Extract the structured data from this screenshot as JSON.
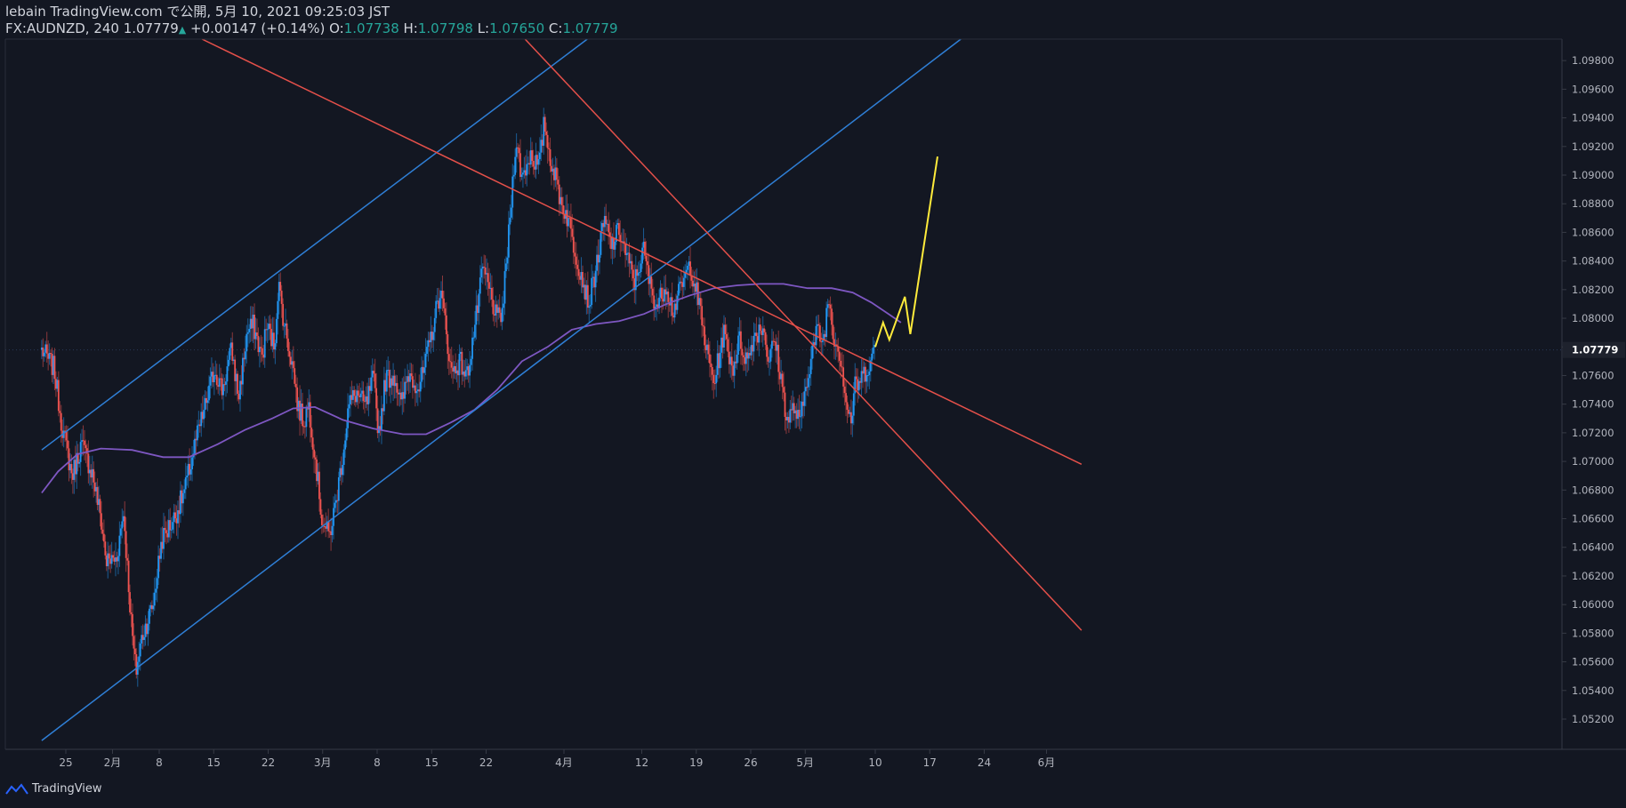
{
  "header": {
    "line1": "lebain TradingView.com で公開, 5月 10, 2021 09:25:03 JST",
    "symbol": "FX:AUDNZD, 240",
    "last": "1.07779",
    "change": "+0.00147 (+0.14%)",
    "o_label": "O:",
    "o_value": "1.07738",
    "h_label": "H:",
    "h_value": "1.07798",
    "l_label": "L:",
    "l_value": "1.07650",
    "c_label": "C:",
    "c_value": "1.07779"
  },
  "footer": {
    "brand": "TradingView"
  },
  "colors": {
    "background": "#131722",
    "up": "#2196f3",
    "down": "#ef5350",
    "ma": "#7e57c2",
    "channel_blue": "#2f7fd6",
    "channel_red": "#e4504a",
    "projection": "#ffeb3b",
    "axis_text": "#b2b5be"
  },
  "chart_data": {
    "type": "candlestick",
    "symbol": "FX:AUDNZD",
    "timeframe": "240",
    "ylim": [
      1.05,
      1.0995
    ],
    "y_ticks": [
      1.052,
      1.054,
      1.056,
      1.058,
      1.06,
      1.062,
      1.064,
      1.066,
      1.068,
      1.07,
      1.072,
      1.074,
      1.076,
      1.078,
      1.08,
      1.082,
      1.084,
      1.086,
      1.088,
      1.09,
      1.092,
      1.094,
      1.096,
      1.098
    ],
    "last_price": 1.07779,
    "last_price_label": "1.07779",
    "x_ticks": [
      {
        "label": "25",
        "day": -6
      },
      {
        "label": "2月",
        "day": 0
      },
      {
        "label": "8",
        "day": 6
      },
      {
        "label": "15",
        "day": 13
      },
      {
        "label": "22",
        "day": 20
      },
      {
        "label": "3月",
        "day": 27
      },
      {
        "label": "8",
        "day": 34
      },
      {
        "label": "15",
        "day": 41
      },
      {
        "label": "22",
        "day": 48
      },
      {
        "label": "4月",
        "day": 58
      },
      {
        "label": "12",
        "day": 68
      },
      {
        "label": "19",
        "day": 75
      },
      {
        "label": "26",
        "day": 82
      },
      {
        "label": "5月",
        "day": 89
      },
      {
        "label": "10",
        "day": 98
      },
      {
        "label": "17",
        "day": 105
      },
      {
        "label": "24",
        "day": 112
      },
      {
        "label": "6月",
        "day": 120
      }
    ],
    "price_path": [
      {
        "day": -9.1,
        "price": 1.0778
      },
      {
        "day": -7.5,
        "price": 1.0765
      },
      {
        "day": -6.5,
        "price": 1.0725
      },
      {
        "day": -5.2,
        "price": 1.069
      },
      {
        "day": -4.0,
        "price": 1.0712
      },
      {
        "day": -2.6,
        "price": 1.0692
      },
      {
        "day": -1.5,
        "price": 1.066
      },
      {
        "day": -0.8,
        "price": 1.063
      },
      {
        "day": 0.5,
        "price": 1.0632
      },
      {
        "day": 1.4,
        "price": 1.0665
      },
      {
        "day": 2.5,
        "price": 1.058
      },
      {
        "day": 3.0,
        "price": 1.0553
      },
      {
        "day": 3.8,
        "price": 1.0578
      },
      {
        "day": 5.2,
        "price": 1.06
      },
      {
        "day": 6.3,
        "price": 1.0645
      },
      {
        "day": 7.9,
        "price": 1.066
      },
      {
        "day": 9.3,
        "price": 1.068
      },
      {
        "day": 10.6,
        "price": 1.0712
      },
      {
        "day": 12.0,
        "price": 1.074
      },
      {
        "day": 13.1,
        "price": 1.0765
      },
      {
        "day": 14.1,
        "price": 1.075
      },
      {
        "day": 15.3,
        "price": 1.0778
      },
      {
        "day": 16.2,
        "price": 1.0745
      },
      {
        "day": 17.3,
        "price": 1.079
      },
      {
        "day": 18.1,
        "price": 1.0795
      },
      {
        "day": 19.2,
        "price": 1.0772
      },
      {
        "day": 19.8,
        "price": 1.0795
      },
      {
        "day": 20.8,
        "price": 1.078
      },
      {
        "day": 21.3,
        "price": 1.0825
      },
      {
        "day": 22.1,
        "price": 1.0795
      },
      {
        "day": 23.3,
        "price": 1.0762
      },
      {
        "day": 23.8,
        "price": 1.0738
      },
      {
        "day": 24.6,
        "price": 1.0728
      },
      {
        "day": 25.2,
        "price": 1.074
      },
      {
        "day": 26.1,
        "price": 1.07
      },
      {
        "day": 26.9,
        "price": 1.066
      },
      {
        "day": 27.8,
        "price": 1.0647
      },
      {
        "day": 28.6,
        "price": 1.0668
      },
      {
        "day": 29.6,
        "price": 1.0705
      },
      {
        "day": 30.3,
        "price": 1.0738
      },
      {
        "day": 31.3,
        "price": 1.0748
      },
      {
        "day": 32.5,
        "price": 1.0738
      },
      {
        "day": 33.5,
        "price": 1.0758
      },
      {
        "day": 34.2,
        "price": 1.072
      },
      {
        "day": 35.1,
        "price": 1.0758
      },
      {
        "day": 36.3,
        "price": 1.076
      },
      {
        "day": 37.1,
        "price": 1.0738
      },
      {
        "day": 38.0,
        "price": 1.0762
      },
      {
        "day": 39.4,
        "price": 1.0752
      },
      {
        "day": 40.1,
        "price": 1.0765
      },
      {
        "day": 41.2,
        "price": 1.0795
      },
      {
        "day": 42.1,
        "price": 1.082
      },
      {
        "day": 42.8,
        "price": 1.0795
      },
      {
        "day": 43.5,
        "price": 1.0762
      },
      {
        "day": 44.7,
        "price": 1.077
      },
      {
        "day": 45.5,
        "price": 1.0758
      },
      {
        "day": 46.7,
        "price": 1.08
      },
      {
        "day": 47.6,
        "price": 1.0835
      },
      {
        "day": 48.5,
        "price": 1.0818
      },
      {
        "day": 49.4,
        "price": 1.0798
      },
      {
        "day": 50.1,
        "price": 1.0805
      },
      {
        "day": 51.0,
        "price": 1.0865
      },
      {
        "day": 51.8,
        "price": 1.0925
      },
      {
        "day": 52.6,
        "price": 1.0898
      },
      {
        "day": 53.7,
        "price": 1.0915
      },
      {
        "day": 54.8,
        "price": 1.0905
      },
      {
        "day": 55.5,
        "price": 1.0938
      },
      {
        "day": 56.0,
        "price": 1.0918
      },
      {
        "day": 56.9,
        "price": 1.0898
      },
      {
        "day": 57.7,
        "price": 1.088
      },
      {
        "day": 58.5,
        "price": 1.087
      },
      {
        "day": 59.5,
        "price": 1.0845
      },
      {
        "day": 60.3,
        "price": 1.083
      },
      {
        "day": 61.2,
        "price": 1.081
      },
      {
        "day": 62.1,
        "price": 1.0835
      },
      {
        "day": 63.2,
        "price": 1.0868
      },
      {
        "day": 64.1,
        "price": 1.085
      },
      {
        "day": 65.1,
        "price": 1.0862
      },
      {
        "day": 66.2,
        "price": 1.084
      },
      {
        "day": 67.1,
        "price": 1.0825
      },
      {
        "day": 68.2,
        "price": 1.0848
      },
      {
        "day": 69.1,
        "price": 1.0822
      },
      {
        "day": 70.0,
        "price": 1.0808
      },
      {
        "day": 71.1,
        "price": 1.0825
      },
      {
        "day": 72.0,
        "price": 1.0805
      },
      {
        "day": 73.1,
        "price": 1.0822
      },
      {
        "day": 74.2,
        "price": 1.0838
      },
      {
        "day": 75.0,
        "price": 1.082
      },
      {
        "day": 75.8,
        "price": 1.0795
      },
      {
        "day": 76.4,
        "price": 1.0775
      },
      {
        "day": 77.3,
        "price": 1.0755
      },
      {
        "day": 78.5,
        "price": 1.079
      },
      {
        "day": 79.7,
        "price": 1.0765
      },
      {
        "day": 80.5,
        "price": 1.0785
      },
      {
        "day": 81.6,
        "price": 1.077
      },
      {
        "day": 82.4,
        "price": 1.0788
      },
      {
        "day": 83.6,
        "price": 1.0795
      },
      {
        "day": 84.3,
        "price": 1.077
      },
      {
        "day": 85.1,
        "price": 1.0785
      },
      {
        "day": 86.1,
        "price": 1.075
      },
      {
        "day": 86.7,
        "price": 1.0728
      },
      {
        "day": 87.6,
        "price": 1.0738
      },
      {
        "day": 88.3,
        "price": 1.0725
      },
      {
        "day": 89.2,
        "price": 1.0758
      },
      {
        "day": 89.8,
        "price": 1.0775
      },
      {
        "day": 90.6,
        "price": 1.0792
      },
      {
        "day": 91.3,
        "price": 1.0782
      },
      {
        "day": 92.0,
        "price": 1.0816
      },
      {
        "day": 92.6,
        "price": 1.079
      },
      {
        "day": 93.6,
        "price": 1.0772
      },
      {
        "day": 94.3,
        "price": 1.074
      },
      {
        "day": 94.9,
        "price": 1.0728
      },
      {
        "day": 95.4,
        "price": 1.0752
      },
      {
        "day": 96.3,
        "price": 1.0758
      },
      {
        "day": 97.3,
        "price": 1.077
      },
      {
        "day": 98.0,
        "price": 1.0778
      }
    ],
    "moving_average": [
      {
        "day": -9.1,
        "price": 1.0678
      },
      {
        "day": -7.0,
        "price": 1.0693
      },
      {
        "day": -4.5,
        "price": 1.0705
      },
      {
        "day": -1.5,
        "price": 1.0709
      },
      {
        "day": 2.5,
        "price": 1.0708
      },
      {
        "day": 6.5,
        "price": 1.0703
      },
      {
        "day": 9.8,
        "price": 1.0703
      },
      {
        "day": 13.5,
        "price": 1.0712
      },
      {
        "day": 17.0,
        "price": 1.0722
      },
      {
        "day": 20.5,
        "price": 1.073
      },
      {
        "day": 23.2,
        "price": 1.0737
      },
      {
        "day": 26.0,
        "price": 1.0738
      },
      {
        "day": 29.6,
        "price": 1.0729
      },
      {
        "day": 33.5,
        "price": 1.0723
      },
      {
        "day": 37.3,
        "price": 1.0719
      },
      {
        "day": 40.3,
        "price": 1.0719
      },
      {
        "day": 43.4,
        "price": 1.0727
      },
      {
        "day": 46.5,
        "price": 1.0736
      },
      {
        "day": 49.4,
        "price": 1.075
      },
      {
        "day": 52.6,
        "price": 1.077
      },
      {
        "day": 55.9,
        "price": 1.078
      },
      {
        "day": 59.0,
        "price": 1.0792
      },
      {
        "day": 62.1,
        "price": 1.0796
      },
      {
        "day": 65.1,
        "price": 1.0798
      },
      {
        "day": 68.3,
        "price": 1.0803
      },
      {
        "day": 71.2,
        "price": 1.081
      },
      {
        "day": 74.2,
        "price": 1.0816
      },
      {
        "day": 77.3,
        "price": 1.0821
      },
      {
        "day": 80.3,
        "price": 1.0823
      },
      {
        "day": 83.2,
        "price": 1.0824
      },
      {
        "day": 86.2,
        "price": 1.0824
      },
      {
        "day": 89.3,
        "price": 1.0821
      },
      {
        "day": 92.4,
        "price": 1.0821
      },
      {
        "day": 95.1,
        "price": 1.0818
      },
      {
        "day": 97.5,
        "price": 1.0811
      },
      {
        "day": 99.7,
        "price": 1.0803
      },
      {
        "day": 101.3,
        "price": 1.0797
      }
    ],
    "trendlines": [
      {
        "color": "blue",
        "p1": {
          "day": -9.1,
          "price": 1.0708
        },
        "p2": {
          "day": 61.0,
          "price": 1.0995
        }
      },
      {
        "color": "blue",
        "p1": {
          "day": -9.1,
          "price": 1.0505
        },
        "p2": {
          "day": 109.0,
          "price": 1.0995
        }
      },
      {
        "color": "red",
        "p1": {
          "day": 11.5,
          "price": 1.0995
        },
        "p2": {
          "day": 124.5,
          "price": 1.0698
        }
      },
      {
        "color": "red",
        "p1": {
          "day": 53.0,
          "price": 1.0995
        },
        "p2": {
          "day": 124.5,
          "price": 1.0582
        }
      }
    ],
    "projection": [
      {
        "day": 98.0,
        "price": 1.078
      },
      {
        "day": 99.0,
        "price": 1.0797
      },
      {
        "day": 99.8,
        "price": 1.0785
      },
      {
        "day": 101.8,
        "price": 1.0815
      },
      {
        "day": 102.5,
        "price": 1.0789
      },
      {
        "day": 106.0,
        "price": 1.0913
      }
    ]
  }
}
